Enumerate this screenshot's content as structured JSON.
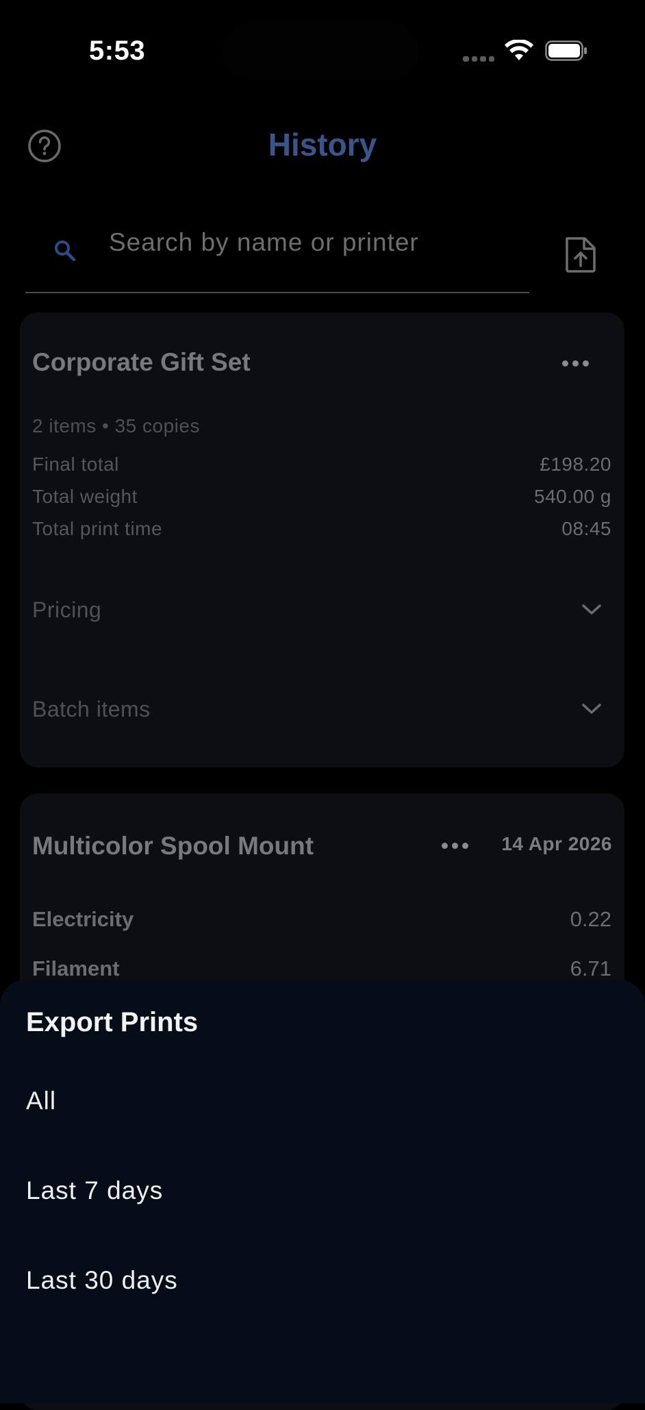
{
  "status_bar": {
    "time": "5:53"
  },
  "header": {
    "title": "History",
    "title_color": "#3a548c",
    "help_icon": "question-circle-icon",
    "export_icon": "file-upload-icon"
  },
  "search": {
    "placeholder": "Search by name or printer",
    "value": ""
  },
  "cards": [
    {
      "title": "Corporate Gift Set",
      "subtitle": "2 items • 35 copies",
      "stats": [
        {
          "label": "Final total",
          "value": "£198.20"
        },
        {
          "label": "Total weight",
          "value": "540.00 g"
        },
        {
          "label": "Total print time",
          "value": "08:45"
        }
      ],
      "sections": [
        {
          "label": "Pricing"
        },
        {
          "label": "Batch items"
        }
      ]
    },
    {
      "title": "Multicolor Spool Mount",
      "date": "14 Apr 2026",
      "breakdown": [
        {
          "label": "Electricity",
          "value": "0.22"
        },
        {
          "label": "Filament",
          "value": "6.71"
        }
      ]
    }
  ],
  "export_sheet": {
    "title": "Export Prints",
    "options": [
      {
        "label": "All"
      },
      {
        "label": "Last 7 days"
      },
      {
        "label": "Last 30 days"
      }
    ],
    "background": "#060d18"
  }
}
